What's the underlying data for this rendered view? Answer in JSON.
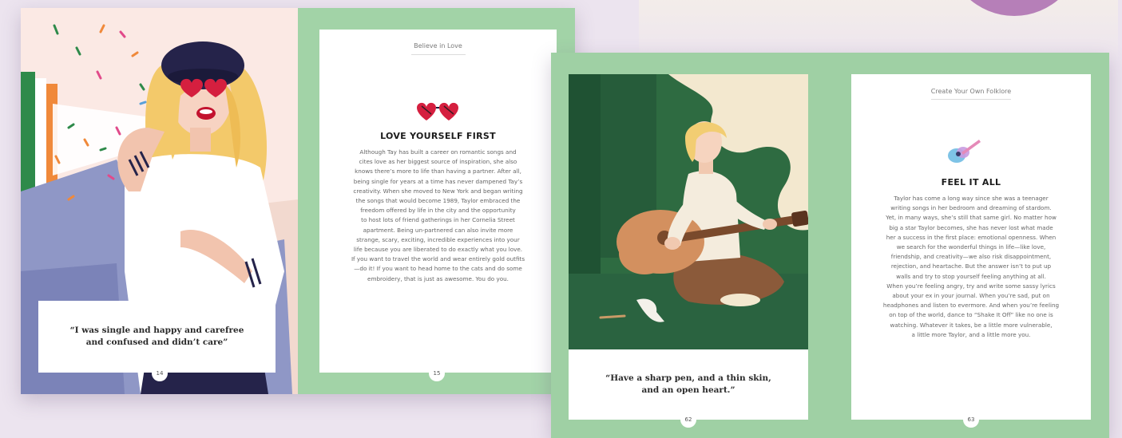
{
  "spread_left": {
    "quote": "“I was single and happy and carefree\nand confused and didn’t care”",
    "left_page_number": "14",
    "right_page_number": "15",
    "header": "Believe in Love",
    "icon": "heart-sunglasses-icon",
    "title": "LOVE YOURSELF FIRST",
    "body_lines": [
      "Although Tay has built a career on romantic songs and",
      "cites love as her biggest source of inspiration, she also",
      "knows there’s more to life than having a partner. After all,",
      "being single for years at a time has never dampened Tay’s",
      "creativity. When she moved to New York and began writing",
      "the songs that would become 1989, Taylor embraced the",
      "freedom offered by life in the city and the opportunity",
      "to host lots of friend gatherings in her Cornelia Street",
      "apartment. Being un-partnered can also invite more",
      "strange, scary, exciting, incredible experiences into your",
      "life because you are liberated to do exactly what you love.",
      "If you want to travel the world and wear entirely gold outfits",
      "—do it! If you want to head home to the cats and do some",
      "embroidery, that is just as awesome. You do you."
    ]
  },
  "spread_right": {
    "quote": "“Have a sharp pen, and a thin skin,\nand an open heart.”",
    "left_page_number": "62",
    "right_page_number": "63",
    "header": "Create Your Own Folklore",
    "icon": "guitar-icon",
    "title": "FEEL IT ALL",
    "body_lines": [
      "Taylor has come a long way since she was a teenager",
      "writing songs in her bedroom and dreaming of stardom.",
      "Yet, in many ways, she’s still that same girl. No matter how",
      "big a star Taylor becomes, she has never lost what made",
      "her a success in the first place: emotional openness. When",
      "we search for the wonderful things in life—like love,",
      "friendship, and creativity—we also risk disappointment,",
      "rejection, and heartache. But the answer isn’t to put up",
      "walls and try to stop yourself feeling anything at all.",
      "When you’re feeling angry, try and write some sassy lyrics",
      "about your ex in your journal. When you’re sad, put on",
      "headphones and listen to evermore. And when you’re feeling",
      "on top of the world, dance to “Shake It Off” like no one is",
      "watching. Whatever it takes, be a little more vulnerable,",
      "a little more Taylor, and a little more you."
    ]
  },
  "colors": {
    "background": "#ece4ef",
    "green": "#a2d3a7",
    "dark_green": "#2e6b41",
    "accent_red": "#d51f3f",
    "navy": "#25234a"
  }
}
